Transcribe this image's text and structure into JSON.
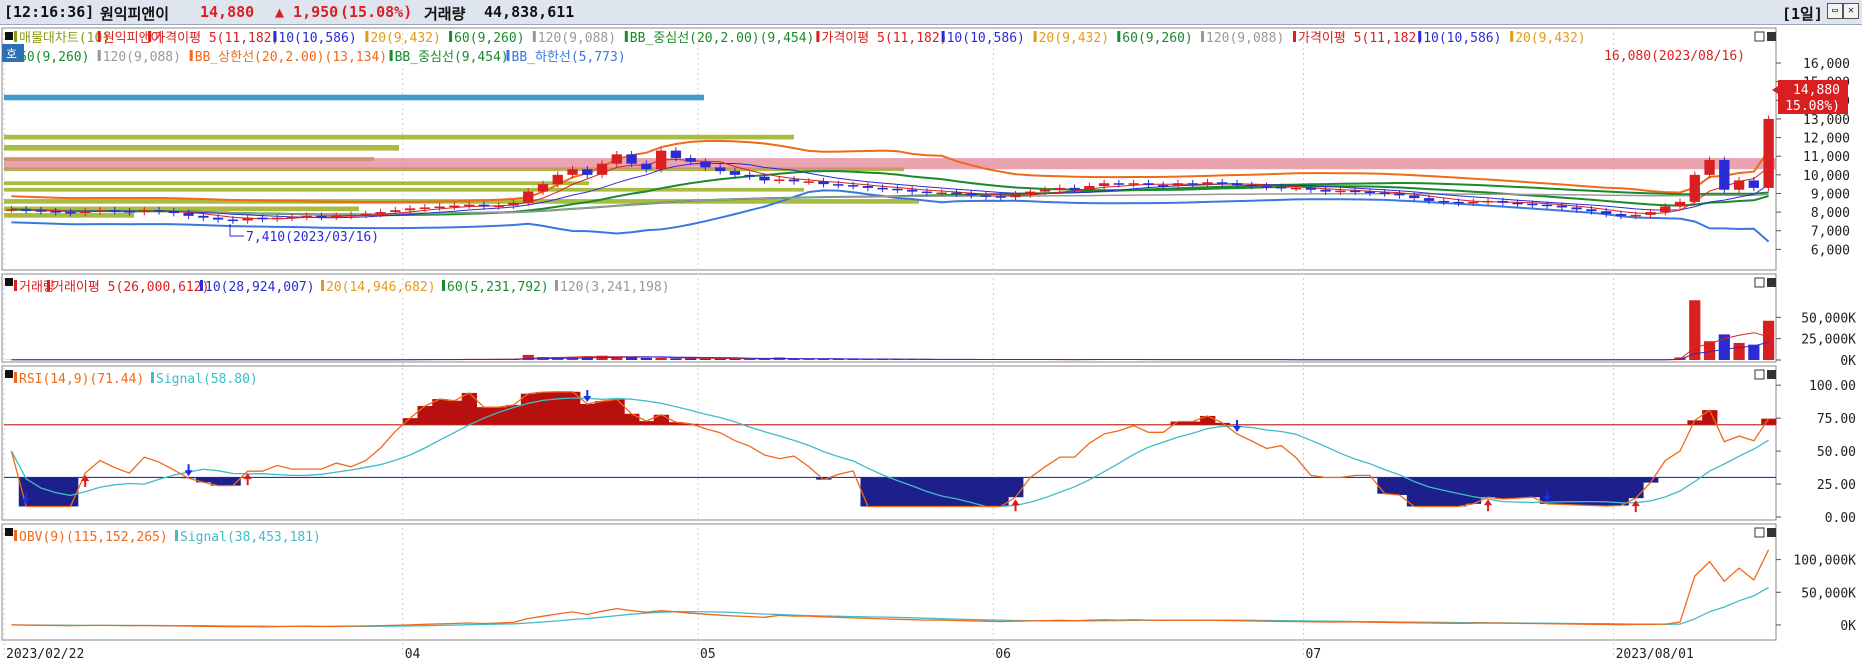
{
  "header": {
    "time": "[12:16:36]",
    "name": "원익피앤이",
    "price": "14,880",
    "change": "▲ 1,950",
    "pct": "(15.08%)",
    "vol_label": "거래량",
    "vol_value": "44,838,611",
    "period": "[1일]"
  },
  "colors": {
    "up": "#d91f1f",
    "down": "#2b2bd4",
    "ma5": "#d91f1f",
    "ma10": "#2b2bd4",
    "ma20": "#e39a1b",
    "ma60": "#1a8a2e",
    "ma120": "#999999",
    "bb_upper": "#f06a1a",
    "bb_mid": "#1a8a2e",
    "bb_lower": "#3a78e0",
    "rsi": "#f06a1a",
    "signal": "#3fbcc8",
    "obv": "#f06a1a"
  },
  "price_panel": {
    "legend_line1": [
      {
        "text": "매물대차트(10)",
        "color": "#8c9a1a"
      },
      {
        "text": "원익피앤이",
        "color": "#d91f1f"
      },
      {
        "text": "가격이평 5(11,182)",
        "color": "#d91f1f"
      },
      {
        "text": "10(10,586)",
        "color": "#2b2bd4"
      },
      {
        "text": "20(9,432)",
        "color": "#e39a1b"
      },
      {
        "text": "60(9,260)",
        "color": "#1a8a2e"
      },
      {
        "text": "120(9,088)",
        "color": "#999999"
      },
      {
        "text": "BB_중심선(20,2.00)(9,454)",
        "color": "#1a8a2e"
      },
      {
        "text": "가격이평 5(11,182)",
        "color": "#d91f1f"
      },
      {
        "text": "10(10,586)",
        "color": "#2b2bd4"
      },
      {
        "text": "20(9,432)",
        "color": "#e39a1b"
      },
      {
        "text": "60(9,260)",
        "color": "#1a8a2e"
      },
      {
        "text": "120(9,088)",
        "color": "#999999"
      },
      {
        "text": "가격이평 5(11,182)",
        "color": "#d91f1f"
      },
      {
        "text": "10(10,586)",
        "color": "#2b2bd4"
      },
      {
        "text": "20(9,432)",
        "color": "#e39a1b"
      }
    ],
    "legend_line2": [
      {
        "text": "60(9,260)",
        "color": "#1a8a2e"
      },
      {
        "text": "120(9,088)",
        "color": "#999999"
      },
      {
        "text": "BB_상한선(20,2.00)(13,134)",
        "color": "#f06a1a"
      },
      {
        "text": "BB_중심선(9,454)",
        "color": "#1a8a2e"
      },
      {
        "text": "BB_하한선(5,773)",
        "color": "#3a78e0"
      }
    ],
    "badge": "호",
    "max_annotation": "16,080(2023/08/16)",
    "min_annotation": "7,410(2023/03/16)",
    "price_tag": "14,880",
    "price_tag_pct": "( 15.08%)"
  },
  "volume_panel": {
    "legend": [
      {
        "text": "거래량",
        "color": "#d91f1f"
      },
      {
        "text": "거래이평 5(26,000,612)",
        "color": "#d91f1f"
      },
      {
        "text": "10(28,924,007)",
        "color": "#2b2bd4"
      },
      {
        "text": "20(14,946,682)",
        "color": "#e39a1b"
      },
      {
        "text": "60(5,231,792)",
        "color": "#1a8a2e"
      },
      {
        "text": "120(3,241,198)",
        "color": "#999999"
      }
    ]
  },
  "rsi_panel": {
    "legend": [
      {
        "text": "RSI(14,9)(71.44)",
        "color": "#f06a1a"
      },
      {
        "text": "Signal(58.80)",
        "color": "#3fbcc8"
      }
    ]
  },
  "obv_panel": {
    "legend": [
      {
        "text": "OBV(9)(115,152,265)",
        "color": "#f06a1a"
      },
      {
        "text": "Signal(38,453,181)",
        "color": "#3fbcc8"
      }
    ]
  },
  "chart_data": [
    {
      "type": "candlestick",
      "name": "price",
      "x_labels": [
        "2023/02/22",
        "04",
        "05",
        "06",
        "07",
        "2023/08/01"
      ],
      "x_label_positions": [
        0,
        27,
        47,
        67,
        88,
        109
      ],
      "n_days": 120,
      "y_ticks": [
        "6,000",
        "7,000",
        "8,000",
        "9,000",
        "10,000",
        "11,000",
        "12,000",
        "13,000",
        "14,000",
        "15,000",
        "16,000"
      ],
      "ylim": [
        5000,
        16700
      ],
      "close": [
        8150,
        8100,
        8050,
        8000,
        7950,
        8050,
        8100,
        8050,
        8000,
        8100,
        8050,
        7950,
        7800,
        7700,
        7600,
        7550,
        7700,
        7650,
        7700,
        7750,
        7800,
        7750,
        7800,
        7850,
        7900,
        8000,
        8100,
        8200,
        8250,
        8300,
        8350,
        8400,
        8300,
        8350,
        8500,
        9100,
        9500,
        10000,
        10300,
        10000,
        10600,
        11100,
        10600,
        10300,
        11300,
        10900,
        10700,
        10400,
        10200,
        10000,
        9900,
        9700,
        9750,
        9650,
        9650,
        9500,
        9450,
        9400,
        9300,
        9250,
        9200,
        9100,
        9050,
        9050,
        9000,
        8900,
        8850,
        8800,
        8950,
        9100,
        9200,
        9300,
        9200,
        9400,
        9550,
        9500,
        9550,
        9450,
        9400,
        9550,
        9500,
        9600,
        9550,
        9450,
        9400,
        9350,
        9300,
        9300,
        9200,
        9100,
        9150,
        9100,
        9050,
        9000,
        8900,
        8750,
        8600,
        8550,
        8500,
        8550,
        8600,
        8500,
        8450,
        8400,
        8350,
        8250,
        8150,
        8050,
        7900,
        7800,
        7850,
        8000,
        8300,
        8550,
        10000,
        10800,
        9200,
        9700,
        9300,
        13000
      ],
      "volume_k": [
        300,
        300,
        300,
        300,
        300,
        300,
        200,
        200,
        200,
        200,
        300,
        300,
        300,
        300,
        300,
        300,
        300,
        400,
        300,
        300,
        300,
        400,
        300,
        300,
        300,
        400,
        500,
        600,
        800,
        600,
        700,
        800,
        900,
        900,
        800,
        6000,
        3500,
        3500,
        3000,
        4000,
        5000,
        4000,
        3000,
        2500,
        2500,
        2000,
        2000,
        1500,
        1500,
        1200,
        1000,
        1000,
        3000,
        1200,
        1000,
        1000,
        900,
        800,
        800,
        700,
        700,
        600,
        600,
        500,
        500,
        500,
        600,
        600,
        500,
        500,
        500,
        500,
        500,
        600,
        600,
        500,
        500,
        500,
        400,
        400,
        400,
        400,
        500,
        400,
        400,
        400,
        400,
        400,
        400,
        300,
        300,
        300,
        300,
        300,
        300,
        300,
        300,
        300,
        300,
        300,
        300,
        300,
        300,
        300,
        300,
        300,
        300,
        300,
        300,
        300,
        300,
        300,
        300,
        3000,
        70000,
        22000,
        30000,
        20000,
        18000,
        46000
      ],
      "vol_y_ticks": [
        "0K",
        "25,000K",
        "50,000K"
      ],
      "vol_max_k": 75000
    },
    {
      "type": "line",
      "name": "rsi",
      "y_ticks": [
        "0.00",
        "25.00",
        "50.00",
        "75.00",
        "100.00"
      ],
      "ylim": [
        0,
        110
      ],
      "thresholds": [
        70,
        30
      ]
    },
    {
      "type": "line",
      "name": "obv",
      "y_ticks": [
        "0K",
        "50,000K",
        "100,000K"
      ],
      "ylim": [
        -20000,
        130000
      ],
      "last_value_k": 115152,
      "signal_last_k": 38453
    }
  ]
}
